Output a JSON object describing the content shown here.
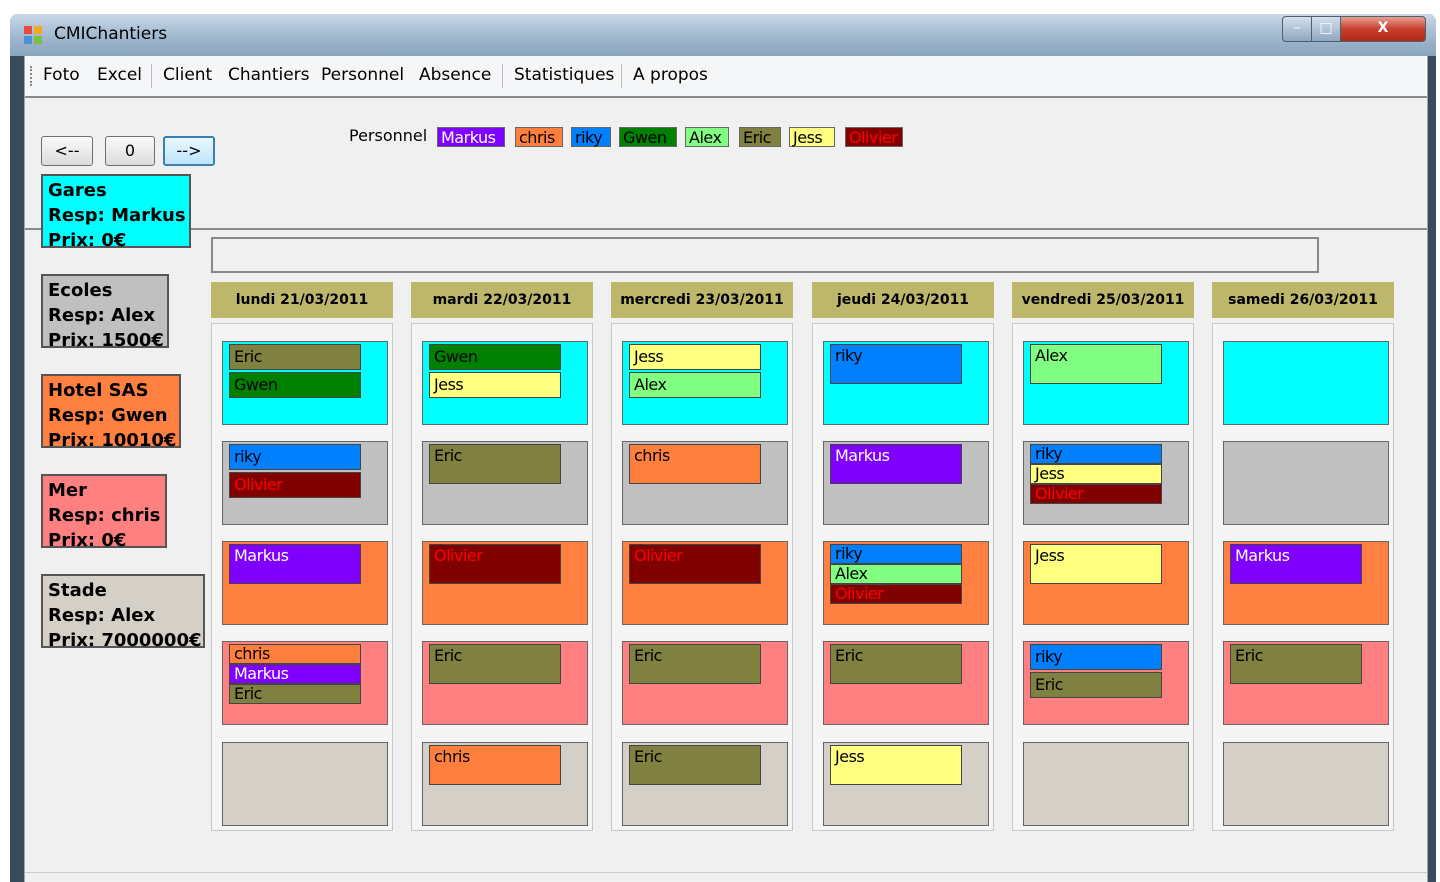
{
  "window": {
    "title": "CMIChantiers",
    "min_glyph": "–",
    "max_glyph": "□",
    "close_glyph": "X",
    "icon_colors": [
      "#e84c3d",
      "#f5a623",
      "#4a90d9",
      "#7ac143"
    ]
  },
  "menu": [
    "Foto",
    "Excel",
    "Client",
    "Chantiers",
    "Personnel",
    "Absence",
    "Statistiques",
    "A propos"
  ],
  "nav": {
    "prev": "<--",
    "today": "0",
    "next": "-->"
  },
  "personnel_label": "Personnel",
  "personnel": [
    {
      "name": "Markus",
      "color": "#8000ff",
      "text": "#ffffff"
    },
    {
      "name": "chris",
      "color": "#ff7f3f",
      "text": "#000000"
    },
    {
      "name": "riky",
      "color": "#0080ff",
      "text": "#000000"
    },
    {
      "name": "Gwen",
      "color": "#008000",
      "text": "#000000"
    },
    {
      "name": "Alex",
      "color": "#80ff80",
      "text": "#000000"
    },
    {
      "name": "Eric",
      "color": "#808040",
      "text": "#000000"
    },
    {
      "name": "Jess",
      "color": "#ffff80",
      "text": "#000000"
    },
    {
      "name": "Olivier",
      "color": "#800000",
      "text": "#ff0000"
    }
  ],
  "days": [
    "lundi 21/03/2011",
    "mardi 22/03/2011",
    "mercredi 23/03/2011",
    "jeudi 24/03/2011",
    "vendredi 25/03/2011",
    "samedi 26/03/2011"
  ],
  "sites": [
    {
      "name": "Gares",
      "resp": "Resp: Markus",
      "prix": "Prix: 0€",
      "color": "#00ffff"
    },
    {
      "name": "Ecoles",
      "resp": "Resp: Alex",
      "prix": "Prix: 1500€",
      "color": "#c0c0c0"
    },
    {
      "name": "Hotel SAS",
      "resp": "Resp: Gwen",
      "prix": "Prix: 10010€",
      "color": "#ff8040"
    },
    {
      "name": "Mer",
      "resp": "Resp: chris",
      "prix": "Prix: 0€",
      "color": "#ff8080"
    },
    {
      "name": "Stade",
      "resp": "Resp: Alex",
      "prix": "Prix: 7000000€",
      "color": "#d4d0c8"
    }
  ],
  "assignments": [
    [
      [
        "Eric",
        "Gwen"
      ],
      [
        "riky",
        "Olivier"
      ],
      [
        "Markus"
      ],
      [
        "chris",
        "Markus",
        "Eric"
      ],
      []
    ],
    [
      [
        "Gwen",
        "Jess"
      ],
      [
        "Eric"
      ],
      [
        "Olivier"
      ],
      [
        "Eric"
      ],
      [
        "chris"
      ]
    ],
    [
      [
        "Jess",
        "Alex"
      ],
      [
        "chris"
      ],
      [
        "Olivier"
      ],
      [
        "Eric"
      ],
      [
        "Eric"
      ]
    ],
    [
      [
        "riky"
      ],
      [
        "Markus"
      ],
      [
        "riky",
        "Alex",
        "Olivier"
      ],
      [
        "Eric"
      ],
      [
        "Jess"
      ]
    ],
    [
      [
        "Alex"
      ],
      [
        "riky",
        "Jess",
        "Olivier"
      ],
      [
        "Jess"
      ],
      [
        "riky",
        "Eric"
      ],
      []
    ],
    [
      [],
      [],
      [
        "Markus"
      ],
      [
        "Eric"
      ],
      []
    ]
  ]
}
